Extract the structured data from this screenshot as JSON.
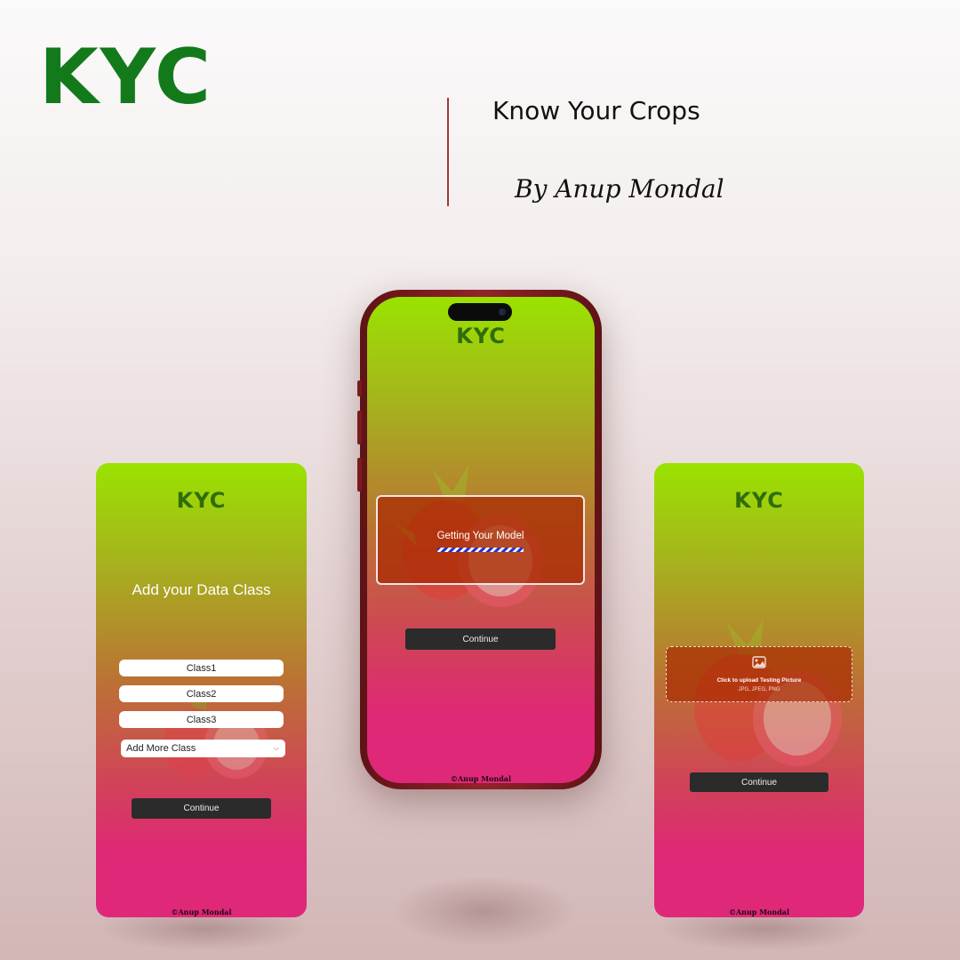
{
  "header": {
    "logo": "KYC",
    "title": "Know Your Crops",
    "author": "By Anup Mondal"
  },
  "screen_left": {
    "logo": "KYC",
    "heading": "Add your Data Class",
    "classes": [
      "Class1",
      "Class2",
      "Class3"
    ],
    "add_more_label": "Add More Class",
    "continue_label": "Continue",
    "footer": "©Anup Mondal"
  },
  "screen_center": {
    "logo": "KYC",
    "loading_text": "Getting Your Model",
    "progress": 0.6,
    "continue_label": "Continue",
    "footer": "©Anup Mondal"
  },
  "screen_right": {
    "logo": "KYC",
    "upload_label": "Click to upload Testing Picture",
    "upload_hint": "JPG, JPEG, PNG",
    "continue_label": "Continue",
    "footer": "©Anup Mondal"
  },
  "colors": {
    "brand_green": "#137a1c",
    "app_logo_green": "#2f6d0a",
    "gradient_top": "#9ae300",
    "gradient_bottom": "#e0287a",
    "button_dark": "#2b2b2b",
    "phone_frame": "#93232a"
  },
  "icons": [
    "chevron-down-icon",
    "image-icon",
    "dragon-fruit-illustration"
  ]
}
